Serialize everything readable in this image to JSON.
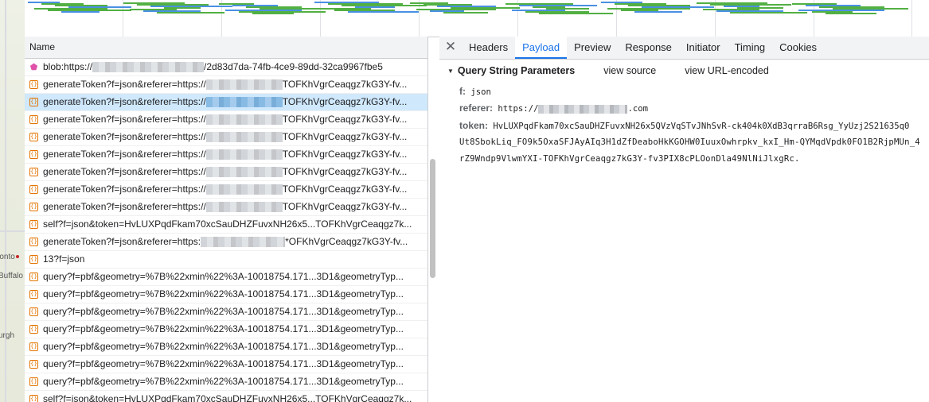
{
  "map": {
    "labels": [
      "ronto",
      "Buffalo",
      "urgh"
    ]
  },
  "list": {
    "header": "Name",
    "rows": [
      {
        "icon": "blob-icon",
        "prefix": "blob:https://",
        "suffix": "/2d83d7da-74fb-4ce9-89dd-32ca9967fbe5",
        "masked": true,
        "selected": false
      },
      {
        "icon": "xhr-icon",
        "prefix": "generateToken?f=json&referer=https://",
        "suffix": "TOFKhVgrCeaqgz7kG3Y-fv...",
        "masked": true,
        "selected": false
      },
      {
        "icon": "xhr-icon",
        "prefix": "generateToken?f=json&referer=https://",
        "suffix": "TOFKhVgrCeaqgz7kG3Y-fv...",
        "masked": true,
        "selected": true
      },
      {
        "icon": "xhr-icon",
        "prefix": "generateToken?f=json&referer=https://",
        "suffix": "TOFKhVgrCeaqgz7kG3Y-fv...",
        "masked": true,
        "selected": false
      },
      {
        "icon": "xhr-icon",
        "prefix": "generateToken?f=json&referer=https://",
        "suffix": "TOFKhVgrCeaqgz7kG3Y-fv...",
        "masked": true,
        "selected": false
      },
      {
        "icon": "xhr-icon",
        "prefix": "generateToken?f=json&referer=https://",
        "suffix": "TOFKhVgrCeaqgz7kG3Y-fv...",
        "masked": true,
        "selected": false
      },
      {
        "icon": "xhr-icon",
        "prefix": "generateToken?f=json&referer=https://",
        "suffix": "TOFKhVgrCeaqgz7kG3Y-fv...",
        "masked": true,
        "selected": false
      },
      {
        "icon": "xhr-icon",
        "prefix": "generateToken?f=json&referer=https://",
        "suffix": "TOFKhVgrCeaqgz7kG3Y-fv...",
        "masked": true,
        "selected": false
      },
      {
        "icon": "xhr-icon",
        "prefix": "generateToken?f=json&referer=https://",
        "suffix": "TOFKhVgrCeaqgz7kG3Y-fv...",
        "masked": true,
        "selected": false
      },
      {
        "icon": "xhr-icon",
        "prefix": "self?f=json&token=HvLUXPqdFkam70xcSauDHZFuvxNH26x5...TOFKhVgrCeaqgz7k...",
        "suffix": "",
        "masked": false,
        "selected": false
      },
      {
        "icon": "xhr-icon",
        "prefix": "generateToken?f=json&referer=https:",
        "suffix": "*OFKhVgrCeaqgz7kG3Y-fv...",
        "masked": true,
        "selected": false
      },
      {
        "icon": "xhr-icon",
        "prefix": "13?f=json",
        "suffix": "",
        "masked": false,
        "selected": false
      },
      {
        "icon": "xhr-icon",
        "prefix": "query?f=pbf&geometry=%7B%22xmin%22%3A-10018754.171...3D1&geometryTyp...",
        "suffix": "",
        "masked": false,
        "selected": false
      },
      {
        "icon": "xhr-icon",
        "prefix": "query?f=pbf&geometry=%7B%22xmin%22%3A-10018754.171...3D1&geometryTyp...",
        "suffix": "",
        "masked": false,
        "selected": false
      },
      {
        "icon": "xhr-icon",
        "prefix": "query?f=pbf&geometry=%7B%22xmin%22%3A-10018754.171...3D1&geometryTyp...",
        "suffix": "",
        "masked": false,
        "selected": false
      },
      {
        "icon": "xhr-icon",
        "prefix": "query?f=pbf&geometry=%7B%22xmin%22%3A-10018754.171...3D1&geometryTyp...",
        "suffix": "",
        "masked": false,
        "selected": false
      },
      {
        "icon": "xhr-icon",
        "prefix": "query?f=pbf&geometry=%7B%22xmin%22%3A-10018754.171...3D1&geometryTyp...",
        "suffix": "",
        "masked": false,
        "selected": false
      },
      {
        "icon": "xhr-icon",
        "prefix": "query?f=pbf&geometry=%7B%22xmin%22%3A-10018754.171...3D1&geometryTyp...",
        "suffix": "",
        "masked": false,
        "selected": false
      },
      {
        "icon": "xhr-icon",
        "prefix": "query?f=pbf&geometry=%7B%22xmin%22%3A-10018754.171...3D1&geometryTyp...",
        "suffix": "",
        "masked": false,
        "selected": false
      },
      {
        "icon": "xhr-icon",
        "prefix": "self?f=json&token=HvLUXPqdFkam70xcSauDHZFuvxNH26x5...TOFKhVgrCeaqgz7k...",
        "suffix": "",
        "masked": false,
        "selected": false
      }
    ]
  },
  "details": {
    "close_label": "✕",
    "tabs": [
      "Headers",
      "Payload",
      "Preview",
      "Response",
      "Initiator",
      "Timing",
      "Cookies"
    ],
    "active_tab": "Payload",
    "section_title": "Query String Parameters",
    "view_source": "view source",
    "view_url_encoded": "view URL-encoded",
    "params": {
      "f_key": "f:",
      "f_value": "json",
      "referer_key": "referer:",
      "referer_prefix": "https://",
      "referer_suffix": ".com",
      "token_key": "token:",
      "token_line1": "HvLUXPqdFkam70xcSauDHZFuvxNH26x5QVzVqSTvJNhSvR-ck404k0XdB3qrraB6Rsg_YyUzj2S21635q0",
      "token_line2": "Ut8SbokLiq_FO9k5OxaSFJAyAIq3H1dZfDeaboHkKGOHW0IuuxOwhrpkv_kxI_Hm-QYMqdVpdk0FO1B2RjpMUn_4",
      "token_line3": "rZ9Wndp9VlwmYXI-TOFKhVgrCeaqgz7kG3Y-fv3PIX8cPLOonDla49NlNiJlxgRc."
    }
  },
  "colors": {
    "accent": "#1a73e8",
    "selected_row": "#cfe8fc",
    "xhr_icon": "#e37400",
    "blob_icon": "#e052a9",
    "timeline_green": "#52b043",
    "timeline_blue": "#4a90e2"
  }
}
